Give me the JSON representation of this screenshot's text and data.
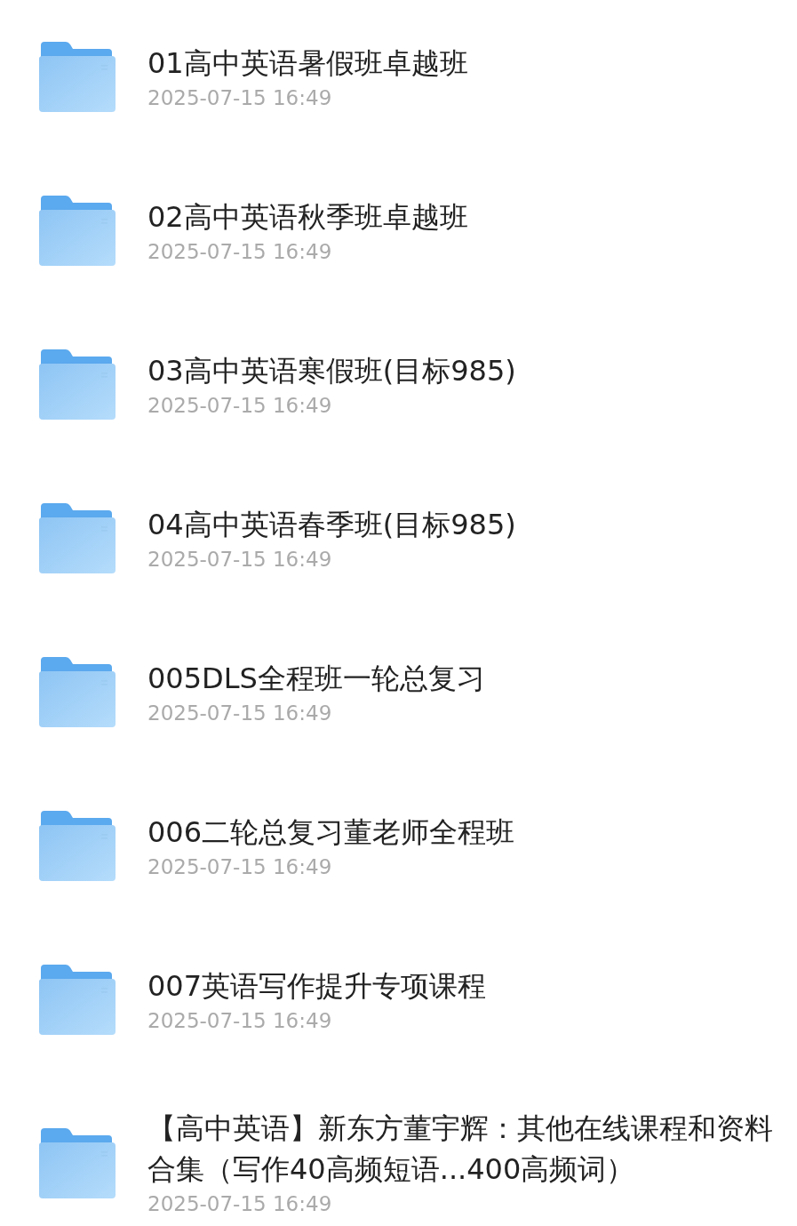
{
  "files": [
    {
      "name": "01高中英语暑假班卓越班",
      "date": "2025-07-15 16:49"
    },
    {
      "name": "02高中英语秋季班卓越班",
      "date": "2025-07-15 16:49"
    },
    {
      "name": "03高中英语寒假班(目标985)",
      "date": "2025-07-15 16:49"
    },
    {
      "name": "04高中英语春季班(目标985)",
      "date": "2025-07-15 16:49"
    },
    {
      "name": "005DLS全程班一轮总复习",
      "date": "2025-07-15 16:49"
    },
    {
      "name": "006二轮总复习董老师全程班",
      "date": "2025-07-15 16:49"
    },
    {
      "name": "007英语写作提升专项课程",
      "date": "2025-07-15 16:49"
    },
    {
      "name": "【高中英语】新东方董宇辉：其他在线课程和资料合集（写作40高频短语...400高频词）",
      "date": "2025-07-15 16:49"
    }
  ]
}
